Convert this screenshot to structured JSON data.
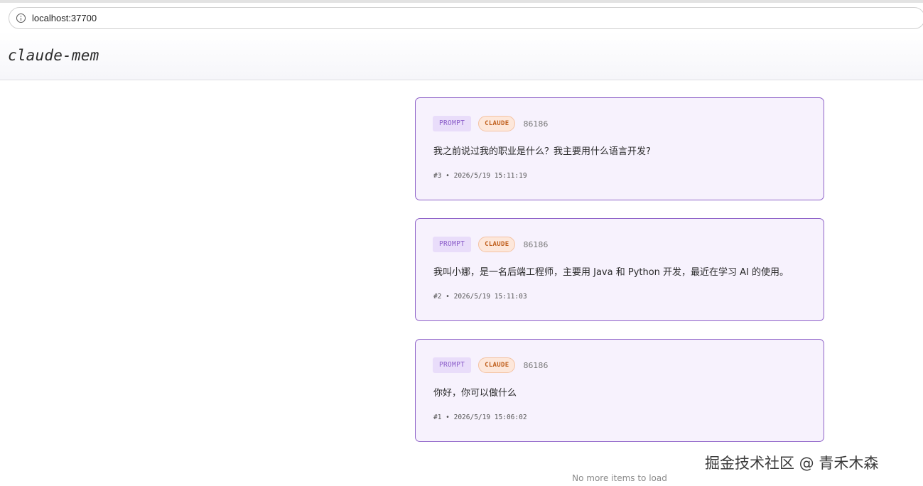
{
  "browser": {
    "url": "localhost:37700"
  },
  "header": {
    "title": "claude-mem"
  },
  "cards": [
    {
      "type_label": "PROMPT",
      "source_label": "CLAUDE",
      "session": "86186",
      "text": "我之前说过我的职业是什么？我主要用什么语言开发?",
      "meta": "#3 • 2026/5/19 15:11:19"
    },
    {
      "type_label": "PROMPT",
      "source_label": "CLAUDE",
      "session": "86186",
      "text": "我叫小娜，是一名后端工程师，主要用 Java 和 Python 开发，最近在学习 AI 的使用。",
      "meta": "#2 • 2026/5/19 15:11:03"
    },
    {
      "type_label": "PROMPT",
      "source_label": "CLAUDE",
      "session": "86186",
      "text": "你好，你可以做什么",
      "meta": "#1 • 2026/5/19 15:06:02"
    }
  ],
  "footer": {
    "status": "No more items to load"
  },
  "watermark": "掘金技术社区 @ 青禾木森",
  "colors": {
    "card_border": "#8e62c8",
    "card_bg": "#f7f2fd",
    "prompt_tag": "#8a5cc9",
    "claude_tag": "#c0601e"
  }
}
